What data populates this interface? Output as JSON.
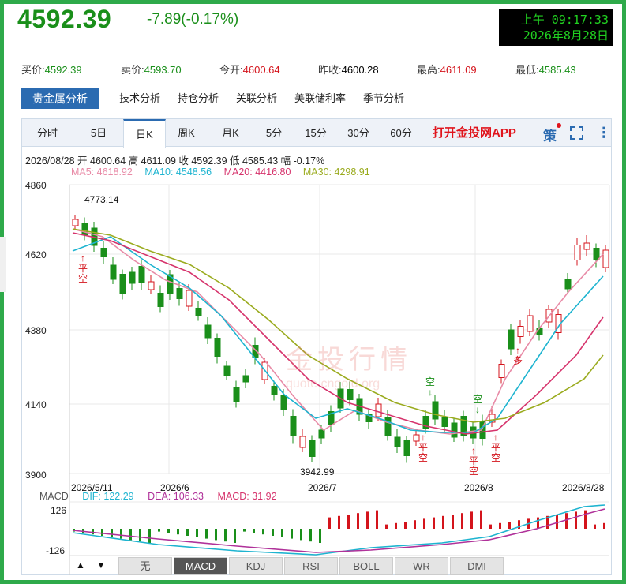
{
  "price": {
    "last": "4592.39",
    "change": "-7.89(-0.17%)"
  },
  "clock": {
    "line1": "上午 09:17:33",
    "line2": "2026年8月28日"
  },
  "quotes": [
    {
      "label": "买价:",
      "value": "4592.39",
      "color": "green"
    },
    {
      "label": "卖价:",
      "value": "4593.70",
      "color": "green"
    },
    {
      "label": "今开:",
      "value": "4600.64",
      "color": "red"
    },
    {
      "label": "昨收:",
      "value": "4600.28",
      "color": "black"
    },
    {
      "label": "最高:",
      "value": "4611.09",
      "color": "red"
    },
    {
      "label": "最低:",
      "value": "4585.43",
      "color": "green"
    }
  ],
  "analysis_tabs": [
    "贵金属分析",
    "技术分析",
    "持仓分析",
    "关联分析",
    "美联储利率",
    "季节分析"
  ],
  "periods": [
    "分时",
    "5日",
    "日K",
    "周K",
    "月K",
    "5分",
    "15分",
    "30分",
    "60分"
  ],
  "active_period": "日K",
  "app_link": "打开金投网APP",
  "strategy_icon": "策",
  "ohlc_info": "2026/08/28  开 4600.64  高 4611.09  收 4592.39  低 4585.43  幅 -0.17%",
  "ma": [
    {
      "label": "MA5: 4618.92",
      "color": "#e88aa6"
    },
    {
      "label": "MA10: 4548.56",
      "color": "#1eb4d0"
    },
    {
      "label": "MA20: 4416.80",
      "color": "#d6336c"
    },
    {
      "label": "MA30: 4298.91",
      "color": "#9aab1e"
    }
  ],
  "y_axis": [
    "4860",
    "4620",
    "4380",
    "4140",
    "3900"
  ],
  "x_axis": [
    "2026/5/11",
    "2026/6",
    "2026/7",
    "2026/8",
    "2026/8/28"
  ],
  "high_label": "4773.14",
  "low_label": "3942.99",
  "watermark": "金投行情",
  "watermark_url": "quote.cngold.org",
  "signals": {
    "s1": "平空",
    "s2": "多",
    "s3": "空",
    "s4": "空",
    "s5": "平空",
    "s6": "平空",
    "s7": "平空"
  },
  "macd": {
    "name": "MACD",
    "dif": "DIF: 122.29",
    "dea": "DEA: 106.33",
    "macd": "MACD: 31.92",
    "y_top": "126",
    "y_bottom": "-126"
  },
  "indicators": [
    "无",
    "MACD",
    "KDJ",
    "RSI",
    "BOLL",
    "WR",
    "DMI"
  ],
  "active_indicator": "MACD",
  "nav_arrows": {
    "up": "▲",
    "down": "▼"
  }
}
